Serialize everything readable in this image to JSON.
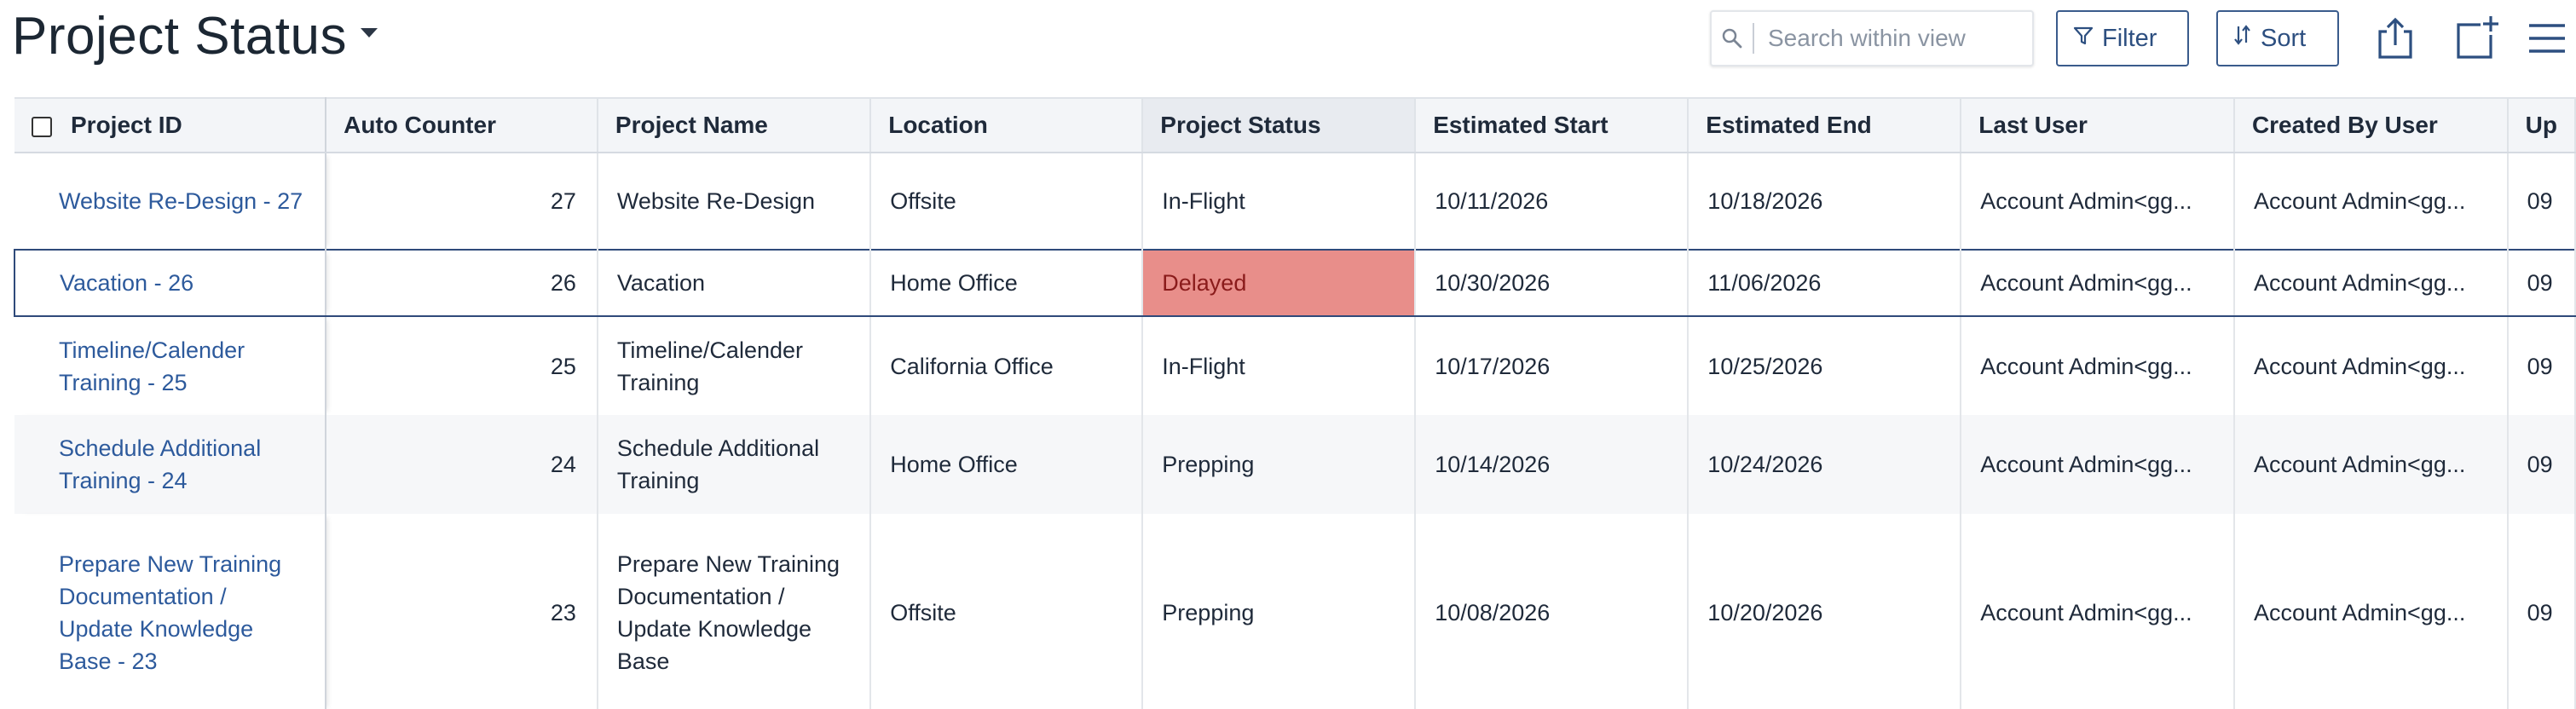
{
  "header": {
    "title": "Project Status",
    "search_placeholder": "Search within view",
    "filter_label": "Filter",
    "sort_label": "Sort",
    "icons": [
      "search-icon",
      "filter-icon",
      "sort-icon",
      "share-icon",
      "add-window-icon",
      "menu-icon"
    ]
  },
  "colors": {
    "accent": "#2d4f80",
    "link": "#2d5a9c",
    "delayed_bg": "#e88e8a",
    "delayed_text": "#8a1b1b"
  },
  "table": {
    "columns": [
      "Project ID",
      "Auto Counter",
      "Project Name",
      "Location",
      "Project Status",
      "Estimated Start",
      "Estimated End",
      "Last User",
      "Created By User",
      "Up"
    ],
    "rows": [
      {
        "id": "Website Re-Design - 27",
        "counter": "27",
        "name": "Website Re-Design",
        "location": "Offsite",
        "status": "In-Flight",
        "start": "10/11/2026",
        "end": "10/18/2026",
        "last_user": "Account Admin<gg...",
        "created_by": "Account Admin<gg...",
        "updated": "09"
      },
      {
        "id": "Vacation - 26",
        "counter": "26",
        "name": "Vacation",
        "location": "Home Office",
        "status": "Delayed",
        "start": "10/30/2026",
        "end": "11/06/2026",
        "last_user": "Account Admin<gg...",
        "created_by": "Account Admin<gg...",
        "updated": "09"
      },
      {
        "id": "Timeline/Calender Training - 25",
        "counter": "25",
        "name": "Timeline/Calender Training",
        "location": "California Office",
        "status": "In-Flight",
        "start": "10/17/2026",
        "end": "10/25/2026",
        "last_user": "Account Admin<gg...",
        "created_by": "Account Admin<gg...",
        "updated": "09"
      },
      {
        "id": "Schedule Additional Training - 24",
        "counter": "24",
        "name": "Schedule Additional Training",
        "location": "Home Office",
        "status": "Prepping",
        "start": "10/14/2026",
        "end": "10/24/2026",
        "last_user": "Account Admin<gg...",
        "created_by": "Account Admin<gg...",
        "updated": "09"
      },
      {
        "id": "Prepare New Training Documentation / Update Knowledge Base - 23",
        "counter": "23",
        "name": "Prepare New Training Documentation / Update Knowledge Base",
        "location": "Offsite",
        "status": "Prepping",
        "start": "10/08/2026",
        "end": "10/20/2026",
        "last_user": "Account Admin<gg...",
        "created_by": "Account Admin<gg...",
        "updated": "09"
      }
    ]
  }
}
